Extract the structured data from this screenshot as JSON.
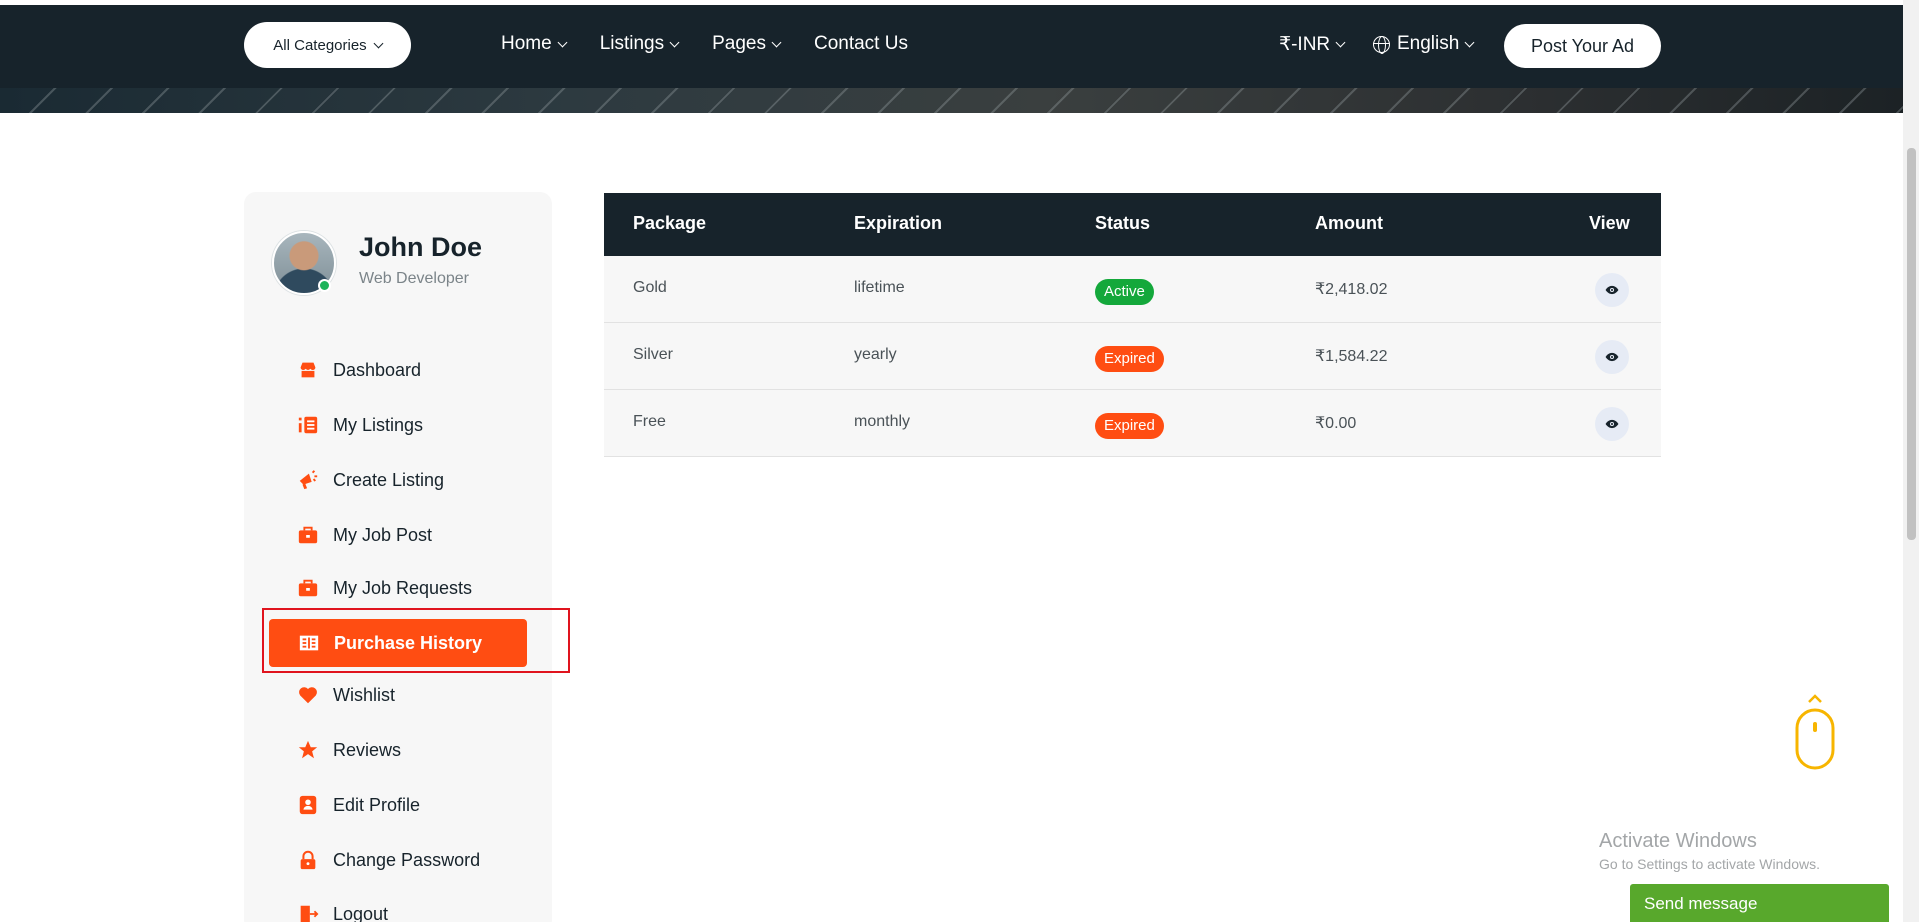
{
  "header": {
    "categories_label": "All Categories",
    "nav": [
      {
        "label": "Home"
      },
      {
        "label": "Listings"
      },
      {
        "label": "Pages"
      },
      {
        "label": "Contact Us"
      }
    ],
    "currency": "₹-INR",
    "language": "English",
    "post_ad_label": "Post Your Ad"
  },
  "profile": {
    "name": "John Doe",
    "role": "Web Developer",
    "online": true
  },
  "sidebar": {
    "items": [
      {
        "label": "Dashboard",
        "icon": "store-icon"
      },
      {
        "label": "My Listings",
        "icon": "list-icon"
      },
      {
        "label": "Create Listing",
        "icon": "megaphone-icon"
      },
      {
        "label": "My Job Post",
        "icon": "briefcase-icon"
      },
      {
        "label": "My Job Requests",
        "icon": "briefcase-icon"
      },
      {
        "label": "Purchase History",
        "icon": "receipt-icon",
        "active": true
      },
      {
        "label": "Wishlist",
        "icon": "heart-icon"
      },
      {
        "label": "Reviews",
        "icon": "star-icon"
      },
      {
        "label": "Edit Profile",
        "icon": "user-card-icon"
      },
      {
        "label": "Change Password",
        "icon": "lock-icon"
      },
      {
        "label": "Logout",
        "icon": "logout-icon"
      }
    ]
  },
  "table": {
    "headers": {
      "package": "Package",
      "expiration": "Expiration",
      "status": "Status",
      "amount": "Amount",
      "view": "View"
    },
    "rows": [
      {
        "package": "Gold",
        "expiration": "lifetime",
        "status": "Active",
        "amount": "₹2,418.02"
      },
      {
        "package": "Silver",
        "expiration": "yearly",
        "status": "Expired",
        "amount": "₹1,584.22"
      },
      {
        "package": "Free",
        "expiration": "monthly",
        "status": "Expired",
        "amount": "₹0.00"
      }
    ]
  },
  "watermark": {
    "title": "Activate Windows",
    "subtitle": "Go to Settings to activate Windows."
  },
  "chat": {
    "label": "Send message"
  },
  "colors": {
    "navbar": "#17232b",
    "accent": "#ff4d12",
    "active_badge": "#14a83b",
    "expired_badge": "#ff4d12",
    "chat_button": "#58a82c"
  }
}
